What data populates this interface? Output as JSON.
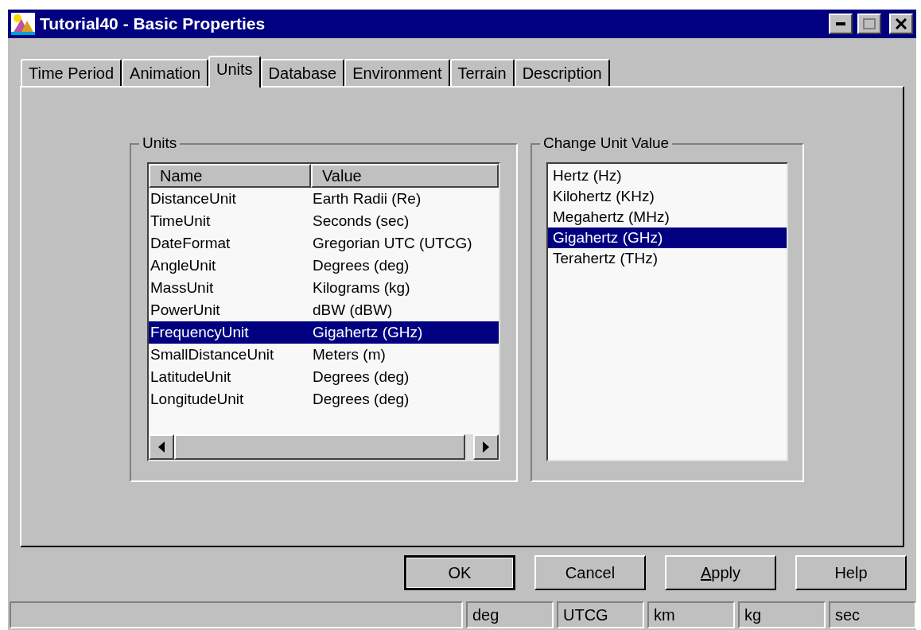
{
  "window": {
    "title": "Tutorial40 - Basic Properties"
  },
  "tabs": [
    {
      "label": "Time Period",
      "selected": false
    },
    {
      "label": "Animation",
      "selected": false
    },
    {
      "label": "Units",
      "selected": true
    },
    {
      "label": "Database",
      "selected": false
    },
    {
      "label": "Environment",
      "selected": false
    },
    {
      "label": "Terrain",
      "selected": false
    },
    {
      "label": "Description",
      "selected": false
    }
  ],
  "units_group": {
    "title": "Units",
    "columns": [
      "Name",
      "Value"
    ],
    "rows": [
      {
        "name": "DistanceUnit",
        "value": "Earth Radii (Re)",
        "selected": false
      },
      {
        "name": "TimeUnit",
        "value": "Seconds (sec)",
        "selected": false
      },
      {
        "name": "DateFormat",
        "value": "Gregorian UTC (UTCG)",
        "selected": false
      },
      {
        "name": "AngleUnit",
        "value": "Degrees (deg)",
        "selected": false
      },
      {
        "name": "MassUnit",
        "value": "Kilograms (kg)",
        "selected": false
      },
      {
        "name": "PowerUnit",
        "value": "dBW (dBW)",
        "selected": false
      },
      {
        "name": "FrequencyUnit",
        "value": "Gigahertz (GHz)",
        "selected": true
      },
      {
        "name": "SmallDistanceUnit",
        "value": "Meters (m)",
        "selected": false
      },
      {
        "name": "LatitudeUnit",
        "value": "Degrees (deg)",
        "selected": false
      },
      {
        "name": "LongitudeUnit",
        "value": "Degrees (deg)",
        "selected": false
      }
    ]
  },
  "change_group": {
    "title": "Change Unit Value",
    "items": [
      {
        "label": "Hertz (Hz)",
        "selected": false
      },
      {
        "label": "Kilohertz (KHz)",
        "selected": false
      },
      {
        "label": "Megahertz (MHz)",
        "selected": false
      },
      {
        "label": "Gigahertz (GHz)",
        "selected": true
      },
      {
        "label": "Terahertz (THz)",
        "selected": false
      }
    ]
  },
  "buttons": [
    {
      "label": "OK",
      "default": true,
      "underline_first": false
    },
    {
      "label": "Cancel",
      "default": false,
      "underline_first": false
    },
    {
      "label": "Apply",
      "default": false,
      "underline_first": true
    },
    {
      "label": "Help",
      "default": false,
      "underline_first": false
    }
  ],
  "status_bar": [
    "deg",
    "UTCG",
    "km",
    "kg",
    "sec"
  ]
}
